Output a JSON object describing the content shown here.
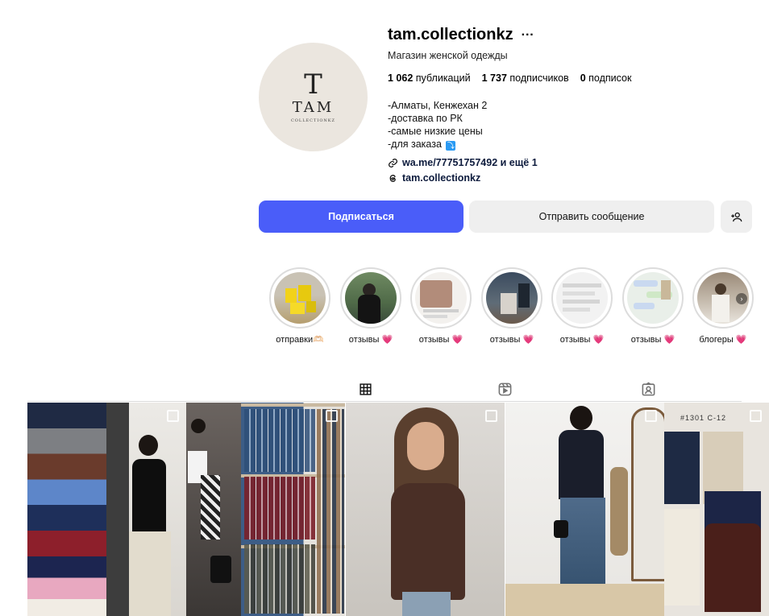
{
  "profile": {
    "username": "tam.collectionkz",
    "category": "Магазин женской одежды",
    "avatar": {
      "logo_letter": "T",
      "logo_name": "TAM",
      "logo_sub": "COLLECTIONKZ"
    },
    "stats": {
      "posts_value": "1 062",
      "posts_label": "публикаций",
      "followers_value": "1 737",
      "followers_label": "подписчиков",
      "following_value": "0",
      "following_label": "подписок"
    },
    "bio": [
      "-Алматы, Кенжехан 2",
      "-доставка по РК",
      "-самые низкие цены",
      "-для заказа"
    ],
    "link": "wa.me/77751757492 и ещё 1",
    "threads": "tam.collectionkz"
  },
  "buttons": {
    "follow": "Подписаться",
    "message": "Отправить сообщение"
  },
  "highlights": [
    {
      "label": "отправки",
      "emoji": "🫶🏻"
    },
    {
      "label": "отзывы",
      "emoji": "💗"
    },
    {
      "label": "отзывы",
      "emoji": "💗"
    },
    {
      "label": "отзывы",
      "emoji": "💗"
    },
    {
      "label": "отзывы",
      "emoji": "💗"
    },
    {
      "label": "отзывы",
      "emoji": "💗"
    },
    {
      "label": "блогеры",
      "emoji": "💗"
    }
  ],
  "posts_overlay": {
    "text_7": "#1301 C-12"
  },
  "colors": {
    "accent": "#4a5df9",
    "heart": "#e6246d"
  },
  "icons": [
    "more-icon",
    "link-icon",
    "threads-icon",
    "add-person-icon",
    "grid-icon",
    "reels-icon",
    "tagged-icon",
    "multi-post-icon"
  ]
}
